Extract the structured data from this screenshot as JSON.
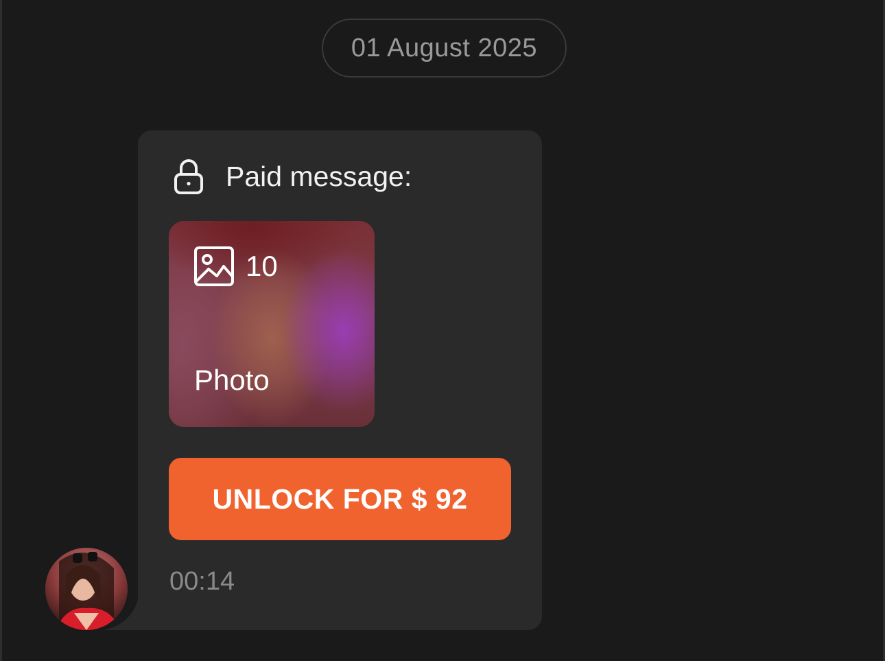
{
  "date_separator": {
    "label": "01 August 2025"
  },
  "message": {
    "header_icon": "lock-icon",
    "header_label": "Paid message:",
    "media": {
      "icon": "image-icon",
      "count": "10",
      "type_label": "Photo"
    },
    "unlock_button_label": "UNLOCK FOR $ 92",
    "time": "00:14",
    "sender_avatar": "avatar"
  },
  "colors": {
    "background": "#1a1a1a",
    "bubble": "#2a2a2a",
    "accent": "#f0622e",
    "muted_text": "#8a8a8a"
  }
}
